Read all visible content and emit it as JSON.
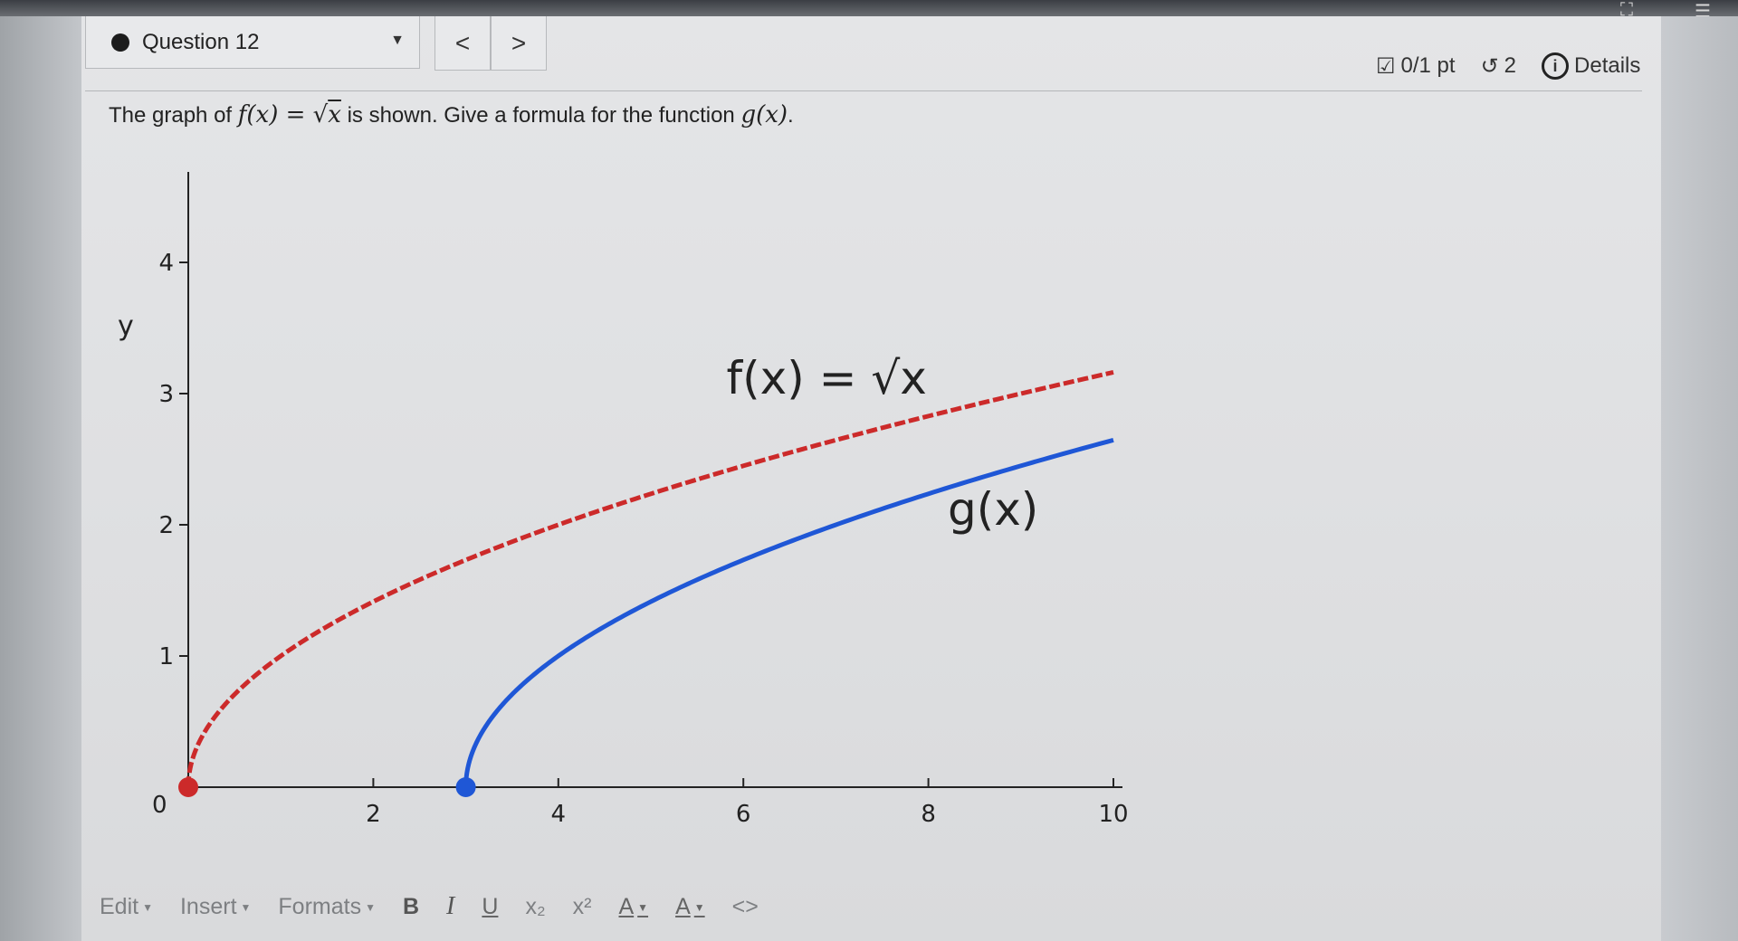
{
  "question_nav": {
    "title": "Question 12",
    "prev_icon": "<",
    "next_icon": ">"
  },
  "meta": {
    "score": "0/1 pt",
    "retries": "2",
    "details_label": "Details"
  },
  "question": {
    "text_before": "The graph of ",
    "f_def": "f(x) = ",
    "sqrt_symbol": "√",
    "radicand": "x",
    "text_middle": " is shown. Give a formula for the function ",
    "g_name": "g(x)",
    "text_after": "."
  },
  "chart_data": {
    "type": "line",
    "ylabel": "y",
    "xlim": [
      0,
      10
    ],
    "ylim": [
      0,
      4
    ],
    "x_ticks": [
      2,
      4,
      6,
      8,
      10
    ],
    "y_ticks": [
      1,
      2,
      3,
      4
    ],
    "origin_label": "0",
    "series": [
      {
        "name": "f(x) = √x",
        "style": "dashed",
        "color": "#cc2a2a",
        "start_point": [
          0,
          0
        ],
        "x": [
          0,
          0.5,
          1,
          2,
          3,
          4,
          5,
          6,
          7,
          8,
          9,
          10
        ],
        "y": [
          0,
          0.71,
          1,
          1.41,
          1.73,
          2,
          2.24,
          2.45,
          2.65,
          2.83,
          3,
          3.16
        ]
      },
      {
        "name": "g(x)",
        "style": "solid",
        "color": "#1f57d6",
        "start_point": [
          3,
          0
        ],
        "x": [
          3,
          3.5,
          4,
          5,
          6,
          7,
          8,
          9,
          10
        ],
        "y": [
          0,
          0.71,
          1,
          1.41,
          1.73,
          2,
          2.24,
          2.45,
          2.65
        ]
      }
    ],
    "annotations": [
      {
        "text": "f(x) = √x",
        "at": [
          6.9,
          3.0
        ]
      },
      {
        "text": "g(x)",
        "at": [
          8.7,
          2.0
        ]
      }
    ]
  },
  "toolbar": {
    "edit": "Edit",
    "insert": "Insert",
    "formats": "Formats",
    "bold": "B",
    "italic": "I",
    "underline": "U",
    "subscript": "x₂",
    "superscript": "x²",
    "font_color": "A",
    "bg_color": "A",
    "code": "<>"
  },
  "colors": {
    "f_curve": "#cc2a2a",
    "g_curve": "#1f57d6"
  }
}
